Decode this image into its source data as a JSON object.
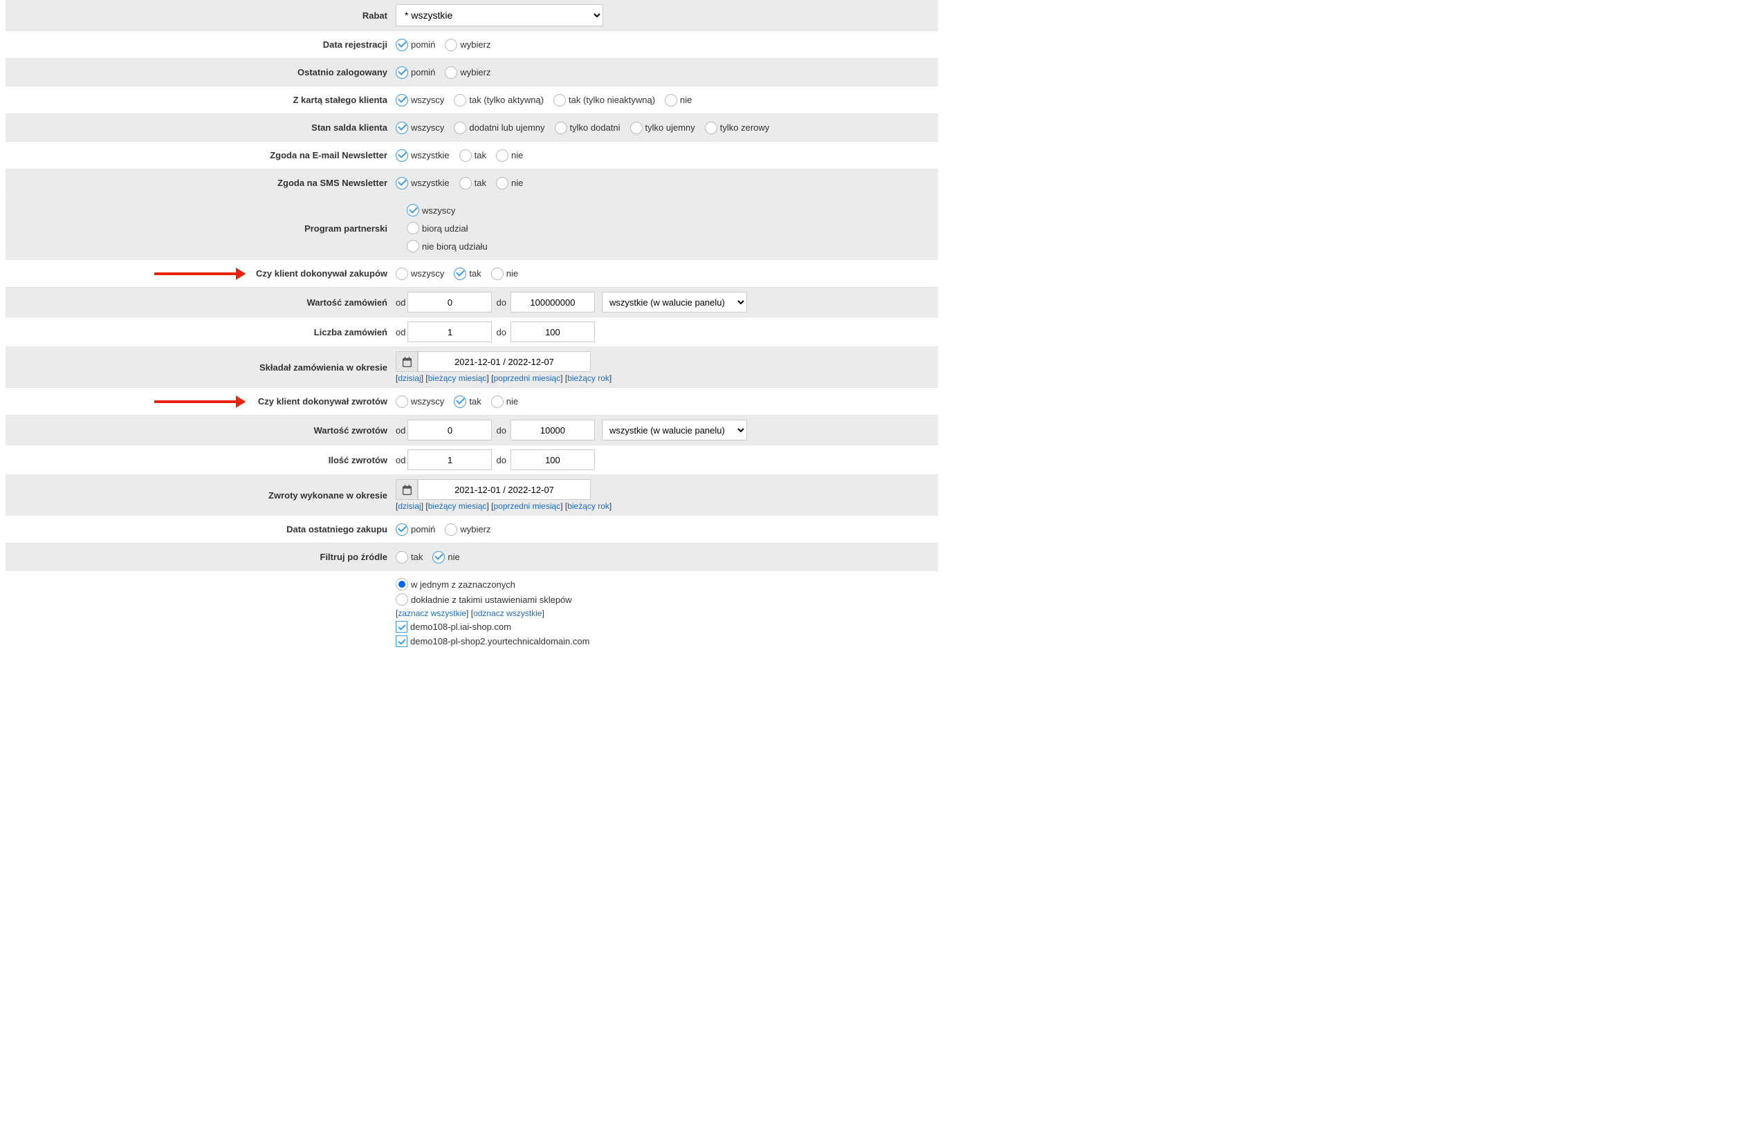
{
  "labels": {
    "rabat": "Rabat",
    "data_rejestracji": "Data rejestracji",
    "ostatnio_zalogowany": "Ostatnio zalogowany",
    "karta_stalego": "Z kartą stałego klienta",
    "stan_salda": "Stan salda klienta",
    "zgoda_email": "Zgoda na E-mail Newsletter",
    "zgoda_sms": "Zgoda na SMS Newsletter",
    "program_partnerski": "Program partnerski",
    "dokonywal_zakupow": "Czy klient dokonywał zakupów",
    "wartosc_zamowien": "Wartość zamówień",
    "liczba_zamowien": "Liczba zamówień",
    "skladal_zamowienia": "Składał zamówienia w okresie",
    "dokonywal_zwrotow": "Czy klient dokonywał zwrotów",
    "wartosc_zwrotow": "Wartość zwrotów",
    "ilosc_zwrotow": "Ilość zwrotów",
    "zwroty_wykonane": "Zwroty wykonane w okresie",
    "data_ostatniego_zakupu": "Data ostatniego zakupu",
    "filtruj_po_zrodle": "Filtruj po źródle"
  },
  "options": {
    "rabat_selected": "* wszystkie",
    "pomin": "pomiń",
    "wybierz": "wybierz",
    "wszyscy": "wszyscy",
    "wszystkie": "wszystkie",
    "tak": "tak",
    "nie": "nie",
    "tak_tylko_aktywna": "tak (tylko aktywną)",
    "tak_tylko_nieaktywna": "tak (tylko nieaktywną)",
    "dodatni_lub_ujemny": "dodatni lub ujemny",
    "tylko_dodatni": "tylko dodatni",
    "tylko_ujemny": "tylko ujemny",
    "tylko_zerowy": "tylko zerowy",
    "biora_udzial": "biorą udział",
    "nie_biora_udzialu": "nie biorą udziału",
    "od": "od",
    "do": "do",
    "currency": "wszystkie (w walucie panelu)",
    "w_jednym": "w jednym z zaznaczonych",
    "dokladnie": "dokładnie z takimi ustawieniami sklepów"
  },
  "values": {
    "wartosc_zamowien_od": "0",
    "wartosc_zamowien_do": "100000000",
    "liczba_zamowien_od": "1",
    "liczba_zamowien_do": "100",
    "date_range_1": "2021-12-01 / 2022-12-07",
    "wartosc_zwrotow_od": "0",
    "wartosc_zwrotow_do": "10000",
    "ilosc_zwrotow_od": "1",
    "ilosc_zwrotow_do": "100",
    "date_range_2": "2021-12-01 / 2022-12-07"
  },
  "date_links": {
    "dzisiaj": "dzisiaj",
    "biezacy_miesiac": "bieżący miesiąc",
    "poprzedni_miesiac": "poprzedni miesiąc",
    "biezacy_rok": "bieżący rok"
  },
  "shops": {
    "zaznacz_wszystkie": "zaznacz wszystkie",
    "odznacz_wszystkie": "odznacz wszystkie",
    "shop1": "demo108-pl.iai-shop.com",
    "shop2": "demo108-pl-shop2.yourtechnicaldomain.com"
  }
}
